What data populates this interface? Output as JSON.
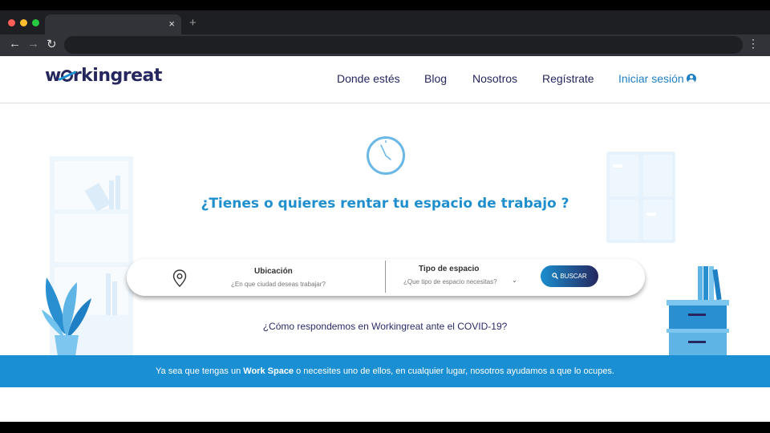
{
  "browser": {
    "traffic_colors": [
      "#ff5f57",
      "#febc2e",
      "#28c840"
    ],
    "tab_close": "×",
    "new_tab": "+",
    "back": "←",
    "forward": "→",
    "reload": "↻",
    "menu": "⋮"
  },
  "header": {
    "logo_prefix": "w",
    "logo_suffix": "rkingreat",
    "nav": [
      "Donde estés",
      "Blog",
      "Nosotros",
      "Regístrate"
    ],
    "login": "Iniciar sesión"
  },
  "hero": {
    "title": "¿Tienes o quieres rentar tu espacio de trabajo ?"
  },
  "search": {
    "location_label": "Ubicación",
    "location_placeholder": "¿En que ciudad deseas trabajar?",
    "type_label": "Tipo de espacio",
    "type_placeholder": "¿Que tipo de espacio necesitas?",
    "chevron": "⌄",
    "button": "BUSCAR"
  },
  "covid_link": "¿Cómo respondemos en Workingreat ante el COVID-19?",
  "banner": {
    "before": "Ya sea que tengas un ",
    "bold": "Work Space",
    "after": " o necesites uno de ellos, en cualquier lugar, nosotros ayudamos a que lo ocupes."
  },
  "colors": {
    "brand_navy": "#25275e",
    "brand_blue": "#1b8fd4",
    "decor_light": "#e6f3fc"
  }
}
